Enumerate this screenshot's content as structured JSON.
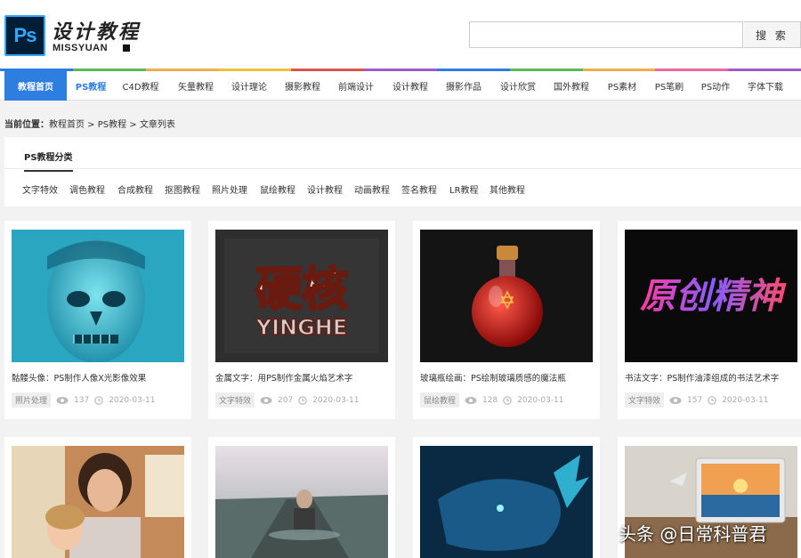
{
  "header": {
    "logo_icon_text": "Ps",
    "logo_title": "设计教程",
    "logo_subtitle": "MISSYUAN",
    "search_placeholder": "",
    "search_button": "搜 索"
  },
  "nav": {
    "items": [
      "教程首页",
      "PS教程",
      "C4D教程",
      "矢量教程",
      "设计理论",
      "摄影教程",
      "前端设计",
      "设计教程",
      "摄影作品",
      "设计欣赏",
      "国外教程",
      "PS素材",
      "PS笔刷",
      "PS动作",
      "字体下载"
    ]
  },
  "breadcrumb": {
    "label": "当前位置：",
    "path": "教程首页 > PS教程 > 文章列表"
  },
  "categories": {
    "tab": "PS教程分类",
    "links": [
      "文字特效",
      "调色教程",
      "合成教程",
      "抠图教程",
      "照片处理",
      "鼠绘教程",
      "设计教程",
      "动画教程",
      "签名教程",
      "LR教程",
      "其他教程"
    ]
  },
  "cards": [
    {
      "title": "骷髅头像：PS制作人像X光影像效果",
      "tag": "照片处理",
      "views": "137",
      "date": "2020-03-11"
    },
    {
      "title": "金属文字：用PS制作金属火焰艺术字",
      "tag": "文字特效",
      "views": "207",
      "date": "2020-03-11"
    },
    {
      "title": "玻璃瓶绘画：PS绘制玻璃质感的魔法瓶",
      "tag": "鼠绘教程",
      "views": "128",
      "date": "2020-03-11"
    },
    {
      "title": "书法文字：PS制作油漆组成的书法艺术字",
      "tag": "文字特效",
      "views": "157",
      "date": "2020-03-11"
    }
  ],
  "thumb_text": {
    "metal_cn": "硬核",
    "metal_en": "YINGHE",
    "calligraphy": "原创精神"
  },
  "watermark": "头条 @日常科普君",
  "colors": {
    "accent": "#2e7de0",
    "rainbow": [
      "#2e7de0",
      "#5cb85c",
      "#f0ad4e",
      "#e8c23a",
      "#d9534f",
      "#a05cc8",
      "#2e7de0",
      "#5cb85c",
      "#f0ad4e",
      "#e86aa0",
      "#a05cc8"
    ]
  }
}
